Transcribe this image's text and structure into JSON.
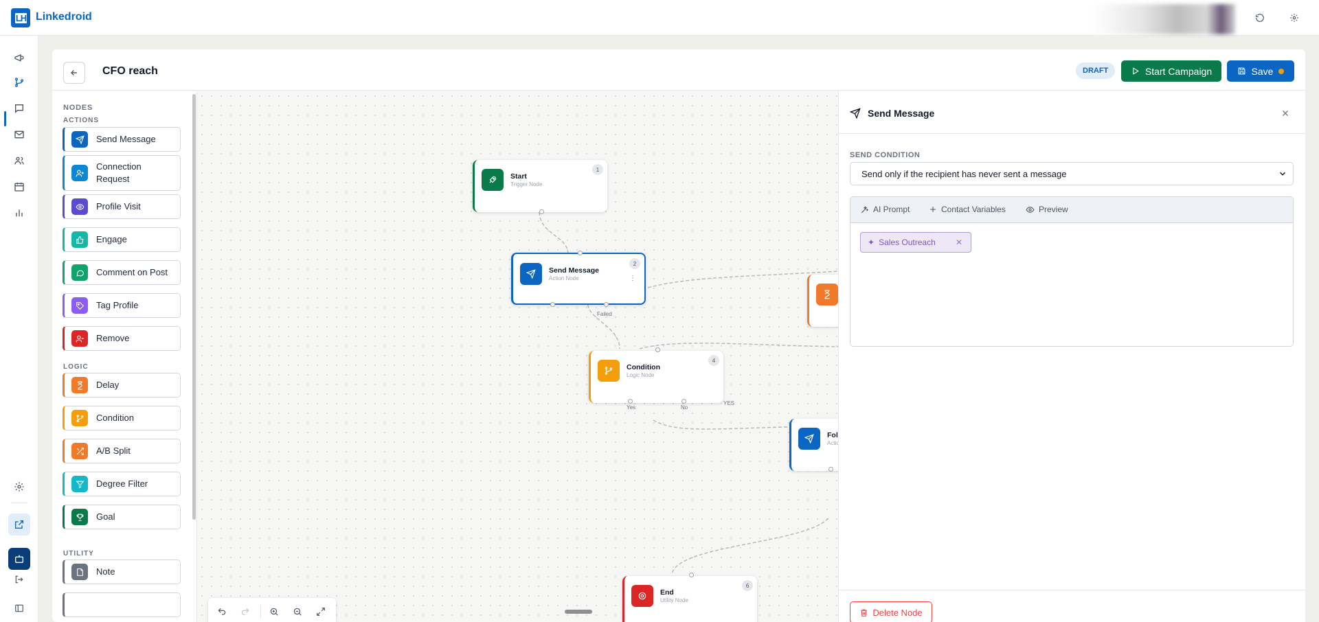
{
  "app": {
    "brand": "Linkedroid",
    "logo_text": "LH"
  },
  "header": {
    "campaign_title": "CFO reach",
    "status_badge": "DRAFT",
    "start_label": "Start Campaign",
    "save_label": "Save"
  },
  "palette": {
    "title": "NODES",
    "sections": [
      {
        "label": "ACTIONS",
        "items": [
          {
            "label": "Send Message",
            "color": "#0a66c2",
            "icon": "send-icon"
          },
          {
            "label": "Connection Request",
            "color": "#0a88d6",
            "icon": "user-plus-icon"
          },
          {
            "label": "Profile Visit",
            "color": "#5b4ccf",
            "icon": "eye-icon"
          },
          {
            "label": "Engage",
            "color": "#14b8a6",
            "icon": "thumbs-up-icon"
          },
          {
            "label": "Comment on Post",
            "color": "#10a36b",
            "icon": "comment-icon"
          },
          {
            "label": "Tag Profile",
            "color": "#8b5cf6",
            "icon": "tag-icon"
          },
          {
            "label": "Remove",
            "color": "#dc2626",
            "icon": "user-minus-icon"
          }
        ]
      },
      {
        "label": "LOGIC",
        "items": [
          {
            "label": "Delay",
            "color": "#f07a2a",
            "icon": "hourglass-icon"
          },
          {
            "label": "Condition",
            "color": "#f59e0b",
            "icon": "branch-icon"
          },
          {
            "label": "A/B Split",
            "color": "#f07a2a",
            "icon": "shuffle-icon"
          },
          {
            "label": "Degree Filter",
            "color": "#14b8c8",
            "icon": "filter-icon"
          },
          {
            "label": "Goal",
            "color": "#0b7a4b",
            "icon": "trophy-icon"
          }
        ]
      },
      {
        "label": "UTILITY",
        "items": [
          {
            "label": "Note",
            "color": "#6b7280",
            "icon": "note-icon"
          }
        ]
      }
    ]
  },
  "canvas": {
    "nodes": [
      {
        "id": "1",
        "title": "Start",
        "subtitle": "Trigger Node",
        "color": "#0b7a4b",
        "icon": "rocket-icon"
      },
      {
        "id": "2",
        "title": "Send Message",
        "subtitle": "Action Node",
        "color": "#0a66c2",
        "icon": "send-icon"
      },
      {
        "id": "4",
        "title": "Condition",
        "subtitle": "Logic Node",
        "color": "#f59e0b",
        "icon": "branch-icon"
      },
      {
        "id": "6",
        "title": "End",
        "subtitle": "Utility Node",
        "color": "#dc2626",
        "icon": "target-icon"
      },
      {
        "id": "",
        "title": "Foll",
        "subtitle": "Actio",
        "color": "#0a66c2",
        "icon": "send-icon"
      },
      {
        "id": "",
        "title": "",
        "subtitle": "",
        "color": "#f07a2a",
        "icon": "hourglass-icon"
      }
    ],
    "edge_labels": {
      "failed": "Failed",
      "yes_port": "Yes",
      "no_port": "No",
      "yes_edge": "YES"
    }
  },
  "panel": {
    "title": "Send Message",
    "send_condition_label": "SEND CONDITION",
    "send_condition_value": "Send only if the recipient has never sent a message",
    "tabs": [
      "AI Prompt",
      "Contact Variables",
      "Preview"
    ],
    "chip_label": "Sales Outreach",
    "delete_label": "Delete Node"
  }
}
